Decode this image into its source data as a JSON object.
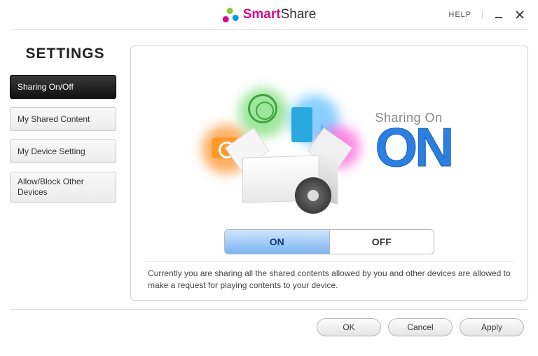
{
  "titlebar": {
    "brand_colored": "Smart",
    "brand_rest": "Share",
    "help": "HELP"
  },
  "sidebar": {
    "heading": "SETTINGS",
    "items": [
      {
        "label": "Sharing On/Off",
        "active": true
      },
      {
        "label": "My Shared Content",
        "active": false
      },
      {
        "label": "My Device Setting",
        "active": false
      },
      {
        "label": "Allow/Block Other Devices",
        "active": false
      }
    ]
  },
  "panel": {
    "status_label": "Sharing On",
    "status_big": "ON",
    "toggle": {
      "on": "ON",
      "off": "OFF",
      "value": "ON"
    },
    "description": "Currently you are sharing all the shared contents allowed by you and other devices are allowed to make a request for playing contents to your device."
  },
  "footer": {
    "ok": "OK",
    "cancel": "Cancel",
    "apply": "Apply"
  }
}
